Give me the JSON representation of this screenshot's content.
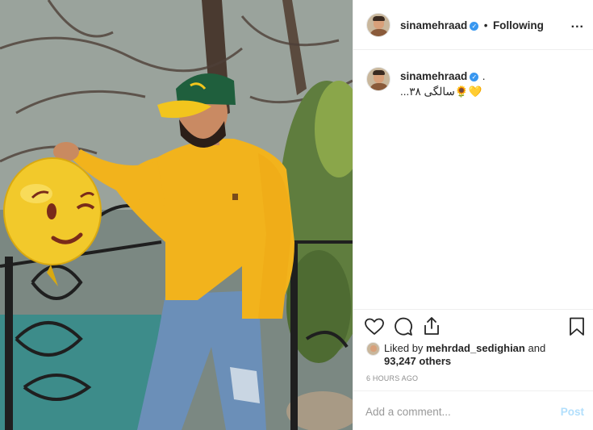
{
  "photo": {
    "alt": ""
  },
  "header": {
    "username": "sinamehraad",
    "verified_glyph": "✓",
    "separator": "•",
    "follow_label": "Following",
    "more_icon": "..."
  },
  "caption": {
    "username": "sinamehraad",
    "verified_glyph": "✓",
    "punct": ".",
    "text": "...سالگی ۳۸🌻💛"
  },
  "actions": {
    "like_icon": "heart-icon",
    "comment_icon": "comment-icon",
    "share_icon": "share-icon",
    "save_icon": "bookmark-icon"
  },
  "likes": {
    "prefix": "Liked by",
    "user": "mehrdad_sedighian",
    "and": "and",
    "count": "93,247 others"
  },
  "time": "6 HOURS AGO",
  "comment": {
    "placeholder": "Add a comment...",
    "post_label": "Post"
  },
  "colors": {
    "verified": "#3897f0",
    "post_button": "#b2dffc",
    "muted": "#8e8e8e"
  }
}
